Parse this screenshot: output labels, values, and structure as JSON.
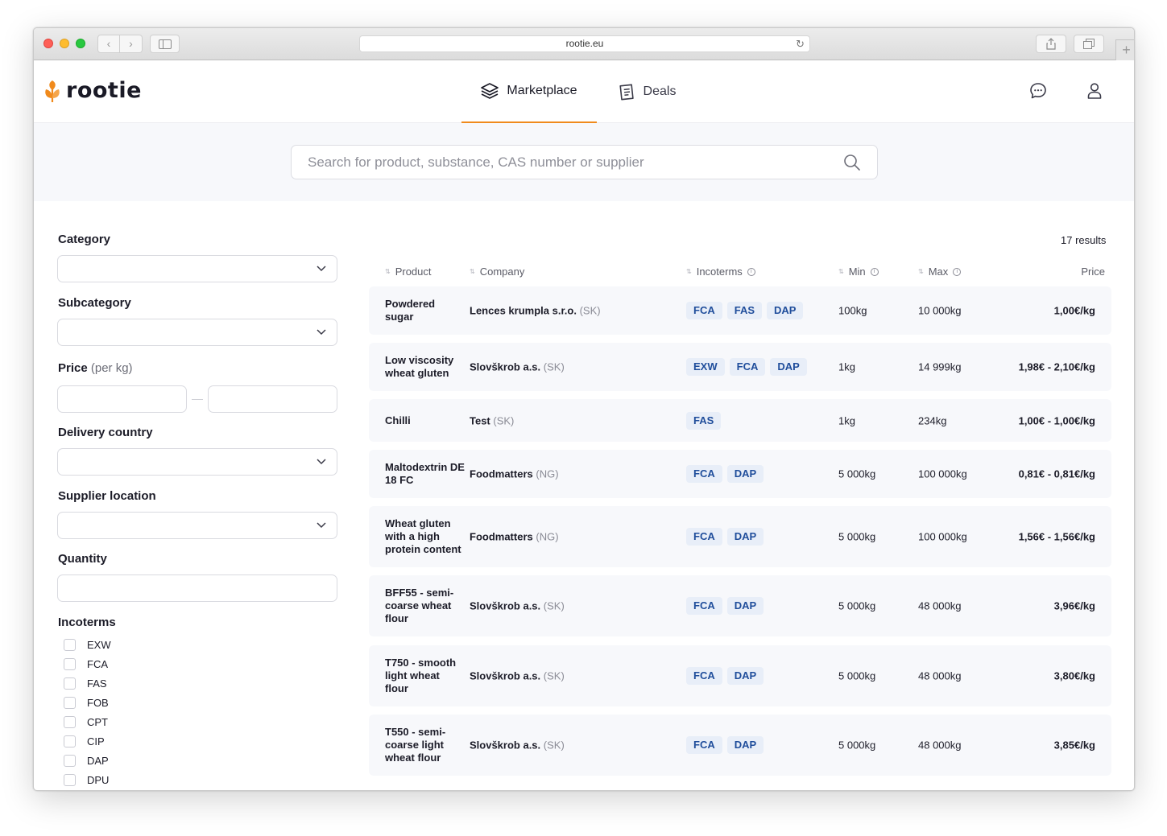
{
  "browser": {
    "url": "rootie.eu",
    "back_glyph": "‹",
    "forward_glyph": "›",
    "newtab_glyph": "+",
    "reload_glyph": "↻"
  },
  "header": {
    "logo_text": "rootie",
    "tabs": [
      {
        "label": "Marketplace",
        "icon": "layers-icon",
        "active": true
      },
      {
        "label": "Deals",
        "icon": "document-list-icon",
        "active": false
      }
    ],
    "icons": [
      "chat-icon",
      "user-icon"
    ],
    "accent": "#f08a1c"
  },
  "search": {
    "placeholder": "Search for product, substance, CAS number or supplier"
  },
  "filters": {
    "category_label": "Category",
    "subcategory_label": "Subcategory",
    "price_label": "Price",
    "price_unit": "(per kg)",
    "delivery_country_label": "Delivery country",
    "supplier_location_label": "Supplier location",
    "quantity_label": "Quantity",
    "incoterms_label": "Incoterms",
    "incoterms": [
      "EXW",
      "FCA",
      "FAS",
      "FOB",
      "CPT",
      "CIP",
      "DAP",
      "DPU"
    ]
  },
  "results": {
    "count_text": "17 results",
    "columns": {
      "product": "Product",
      "company": "Company",
      "incoterms": "Incoterms",
      "min": "Min",
      "max": "Max",
      "price": "Price"
    },
    "rows": [
      {
        "product": "Powdered sugar",
        "company": "Lences krumpla s.r.o.",
        "country": "(SK)",
        "terms": [
          "FCA",
          "FAS",
          "DAP"
        ],
        "min": "100kg",
        "max": "10 000kg",
        "price": "1,00€/kg"
      },
      {
        "product": "Low viscosity wheat gluten",
        "company": "Slovškrob a.s.",
        "country": "(SK)",
        "terms": [
          "EXW",
          "FCA",
          "DAP"
        ],
        "min": "1kg",
        "max": "14 999kg",
        "price": "1,98€ - 2,10€/kg"
      },
      {
        "product": "Chilli",
        "company": "Test",
        "country": "(SK)",
        "terms": [
          "FAS"
        ],
        "min": "1kg",
        "max": "234kg",
        "price": "1,00€ - 1,00€/kg"
      },
      {
        "product": "Maltodextrin DE 18 FC",
        "company": "Foodmatters",
        "country": "(NG)",
        "terms": [
          "FCA",
          "DAP"
        ],
        "min": "5 000kg",
        "max": "100 000kg",
        "price": "0,81€ - 0,81€/kg"
      },
      {
        "product": "Wheat gluten with a high protein content",
        "company": "Foodmatters",
        "country": "(NG)",
        "terms": [
          "FCA",
          "DAP"
        ],
        "min": "5 000kg",
        "max": "100 000kg",
        "price": "1,56€ - 1,56€/kg"
      },
      {
        "product": "BFF55 - semi-coarse wheat flour",
        "company": "Slovškrob a.s.",
        "country": "(SK)",
        "terms": [
          "FCA",
          "DAP"
        ],
        "min": "5 000kg",
        "max": "48 000kg",
        "price": "3,96€/kg"
      },
      {
        "product": "T750 - smooth light wheat flour",
        "company": "Slovškrob a.s.",
        "country": "(SK)",
        "terms": [
          "FCA",
          "DAP"
        ],
        "min": "5 000kg",
        "max": "48 000kg",
        "price": "3,80€/kg"
      },
      {
        "product": "T550 - semi-coarse light wheat flour",
        "company": "Slovškrob a.s.",
        "country": "(SK)",
        "terms": [
          "FCA",
          "DAP"
        ],
        "min": "5 000kg",
        "max": "48 000kg",
        "price": "3,85€/kg"
      }
    ]
  }
}
